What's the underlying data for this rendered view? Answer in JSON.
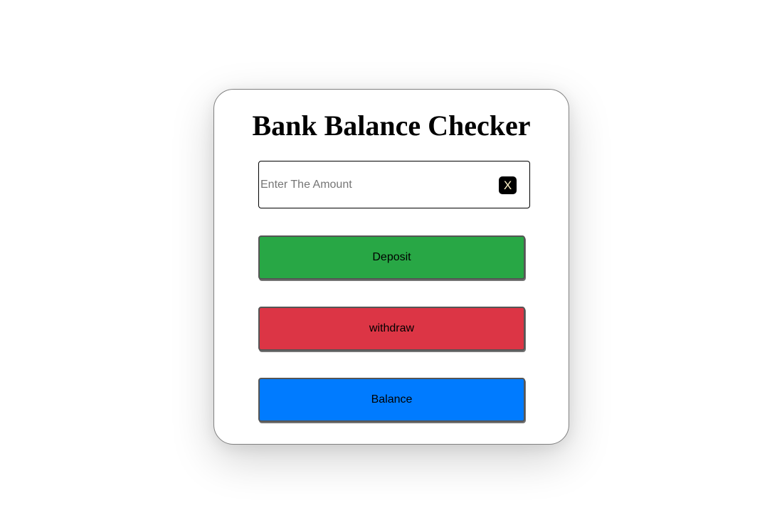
{
  "title": "Bank Balance Checker",
  "amount_input": {
    "value": "",
    "placeholder": "Enter The Amount"
  },
  "clear_button": {
    "label": "X"
  },
  "buttons": {
    "deposit_label": "Deposit",
    "withdraw_label": "withdraw",
    "balance_label": "Balance"
  },
  "colors": {
    "deposit": "#28a745",
    "withdraw": "#dc3545",
    "balance": "#007bff"
  }
}
